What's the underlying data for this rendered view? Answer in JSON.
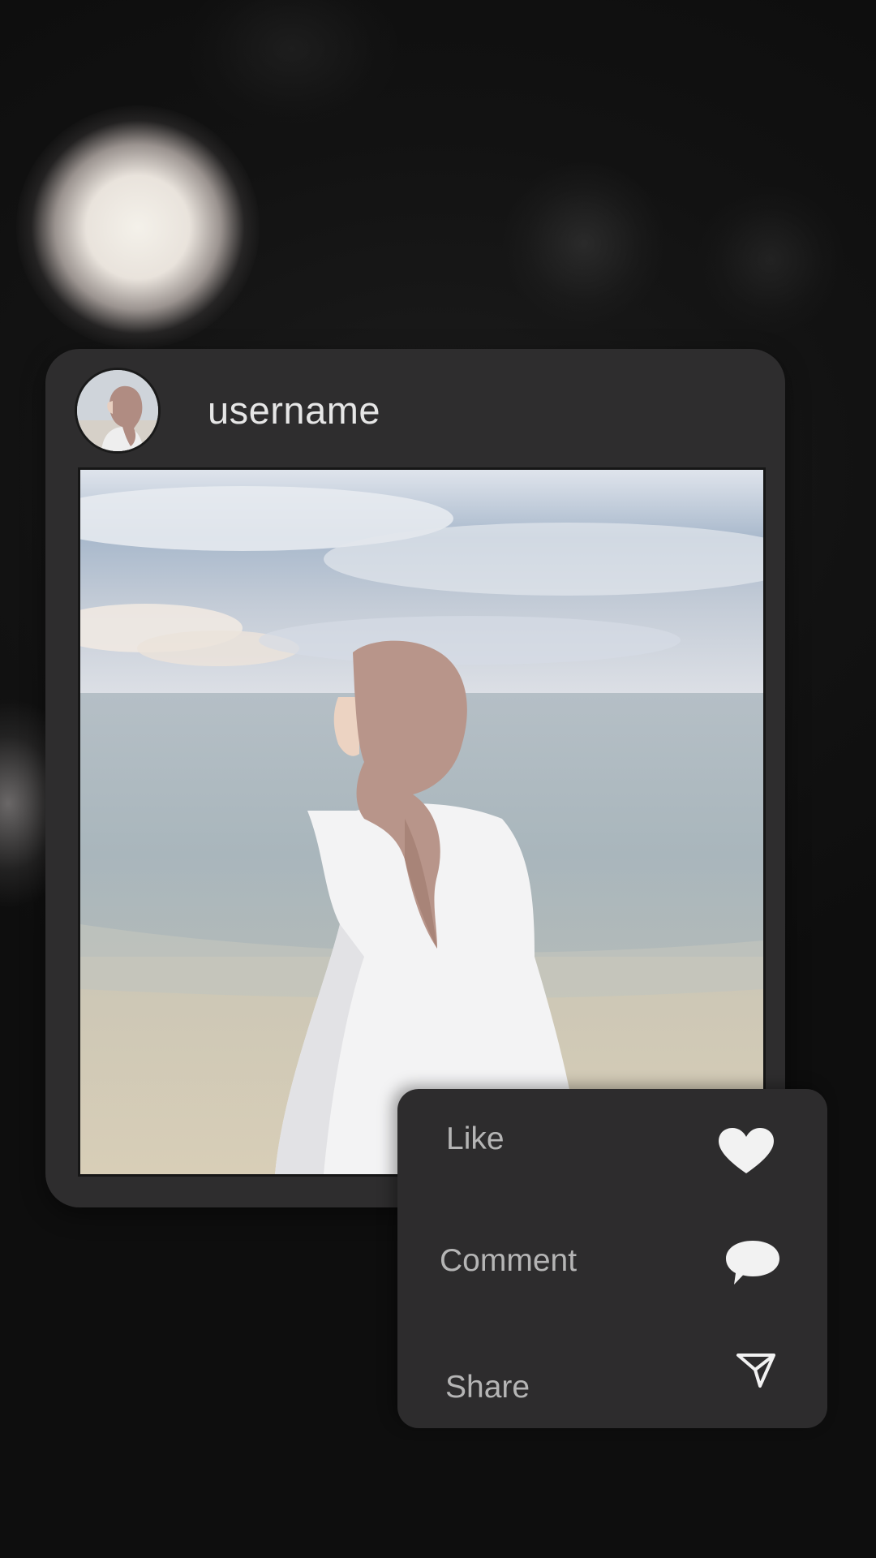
{
  "post": {
    "username": "username"
  },
  "actions": {
    "like_label": "Like",
    "comment_label": "Comment",
    "share_label": "Share"
  },
  "icons": {
    "avatar": "avatar-photo",
    "like": "heart-icon",
    "comment": "speech-bubble-icon",
    "share": "paper-plane-icon"
  },
  "colors": {
    "background": "#111111",
    "card": "#2e2d2e",
    "username_text": "#e6e6e6",
    "action_text": "#b5b5b5",
    "icon_fill": "#f2f2f2"
  }
}
